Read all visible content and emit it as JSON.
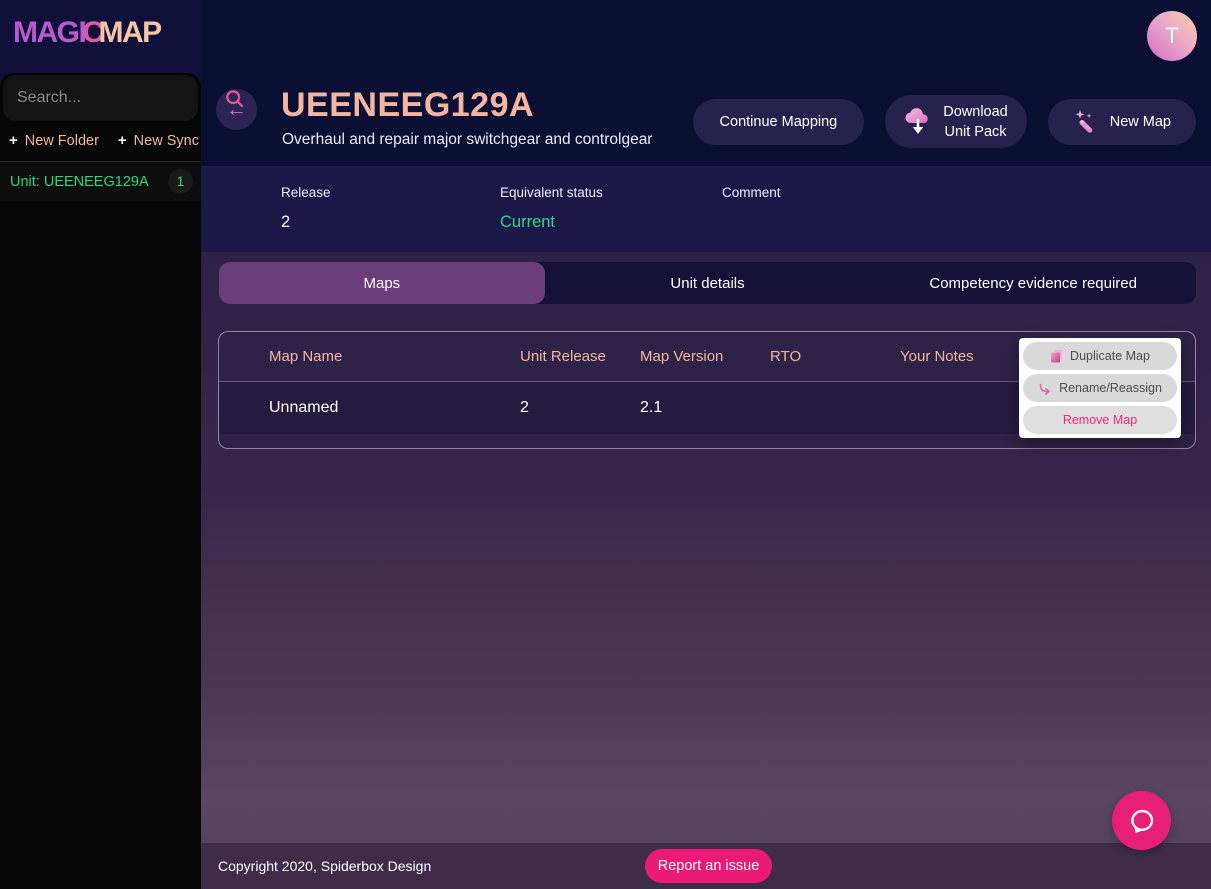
{
  "logo": {
    "part1": "MAGI",
    "part2": "C",
    "part3": "MAP"
  },
  "sidebar": {
    "search_placeholder": "Search...",
    "plus": "+",
    "actions": [
      {
        "label": "New Folder"
      },
      {
        "label": "New Sync"
      }
    ],
    "unit_item": {
      "label": "Unit: UEENEEG129A",
      "badge": "1"
    }
  },
  "topbar": {
    "avatar_initial": "T"
  },
  "header": {
    "back_arrow": "←",
    "title": "UEENEEG129A",
    "subtitle": "Overhaul and repair major switchgear and controlgear",
    "buttons": {
      "continue_mapping": "Continue Mapping",
      "download_line1": "Download",
      "download_line2": "Unit Pack",
      "new_map": "New Map"
    },
    "fields": [
      {
        "label": "Release",
        "value": "2"
      },
      {
        "label": "Equivalent status",
        "value": "Current"
      },
      {
        "label": "Comment",
        "value": ""
      }
    ]
  },
  "tabs": [
    {
      "label": "Maps",
      "active": true
    },
    {
      "label": "Unit details",
      "active": false
    },
    {
      "label": "Competency evidence required",
      "active": false
    }
  ],
  "table": {
    "columns": [
      "Map Name",
      "Unit Release",
      "Map Version",
      "RTO",
      "Your Notes"
    ],
    "rows": [
      {
        "map_name": "Unnamed",
        "unit_release": "2",
        "map_version": "2.1",
        "rto": "",
        "your_notes": ""
      }
    ]
  },
  "context_menu": {
    "items": [
      {
        "label": "Duplicate Map",
        "icon": "duplicate-icon"
      },
      {
        "label": "Rename/Reassign",
        "icon": "rename-icon"
      },
      {
        "label": "Remove Map",
        "icon": null
      }
    ]
  },
  "footer": {
    "copyright": "Copyright 2020, Spiderbox Design",
    "report_button": "Report an issue"
  },
  "colors": {
    "accent_pink": "#ec1a77",
    "status_green": "#2fd985",
    "heading_peach": "#f4b6a0",
    "active_tab_purple": "#6b3d79",
    "header_navy": "#0b0f34",
    "details_navy": "#1d1847",
    "logo_purple": "#ba5bcd",
    "logo_peach": "#f6c6a4"
  }
}
